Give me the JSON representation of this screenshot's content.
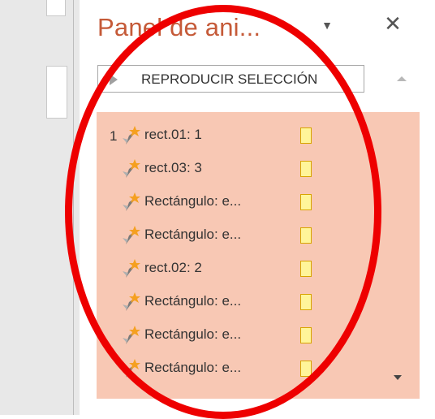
{
  "pane": {
    "title": "Panel de ani...",
    "dropdown_icon": "chevron-down-icon",
    "close_icon": "close-icon",
    "close_glyph": "✕",
    "dropdown_glyph": "▼"
  },
  "play_button": {
    "label": "REPRODUCIR SELECCIÓN",
    "icon": "play-icon"
  },
  "animation_list": {
    "items": [
      {
        "number": "1",
        "label": "rect.01: 1",
        "icon": "star-effect-icon"
      },
      {
        "number": "",
        "label": "rect.03: 3",
        "icon": "star-effect-icon"
      },
      {
        "number": "",
        "label": "Rectángulo: e...",
        "icon": "star-effect-icon"
      },
      {
        "number": "",
        "label": "Rectángulo: e...",
        "icon": "star-effect-icon"
      },
      {
        "number": "",
        "label": "rect.02: 2",
        "icon": "star-effect-icon"
      },
      {
        "number": "",
        "label": "Rectángulo: e...",
        "icon": "star-effect-icon"
      },
      {
        "number": "",
        "label": "Rectángulo: e...",
        "icon": "star-effect-icon"
      },
      {
        "number": "",
        "label": "Rectángulo: e...",
        "icon": "star-effect-icon"
      }
    ]
  },
  "colors": {
    "list_background": "#f8c8b4",
    "title": "#c55a38",
    "highlight": "#ee0000",
    "timing_fill": "#fff59a",
    "timing_border": "#d8a400"
  }
}
